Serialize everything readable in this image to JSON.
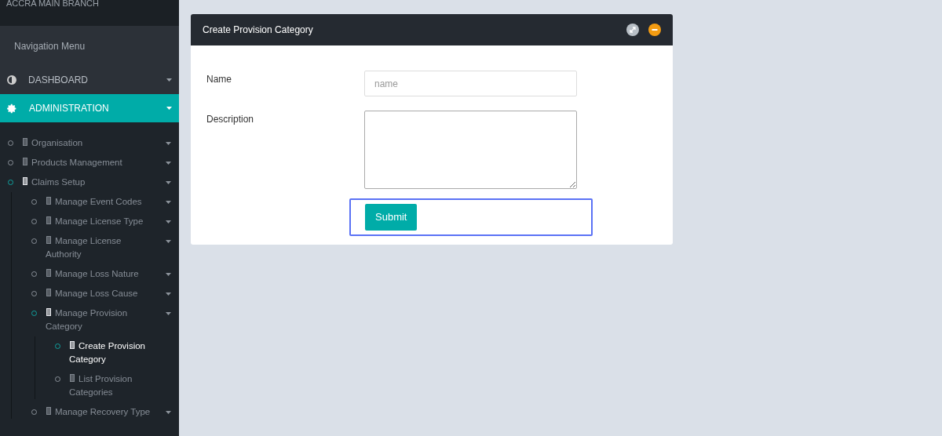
{
  "sidebar": {
    "branch": "ACCRA MAIN BRANCH",
    "nav_heading": "Navigation Menu",
    "sections": [
      {
        "label": "DASHBOARD",
        "kind": "dashboard",
        "selected": false
      },
      {
        "label": "ADMINISTRATION",
        "kind": "settings",
        "selected": true
      }
    ],
    "tree": [
      {
        "label": "Organisation",
        "active": false,
        "has_caret": true
      },
      {
        "label": "Products Management",
        "active": false,
        "has_caret": true
      },
      {
        "label": "Claims Setup",
        "active": true,
        "has_caret": true,
        "children": [
          {
            "label": "Manage Event Codes",
            "active": false,
            "has_caret": true
          },
          {
            "label": "Manage License Type",
            "active": false,
            "has_caret": true
          },
          {
            "label": "Manage License Authority",
            "active": false,
            "has_caret": true
          },
          {
            "label": "Manage Loss Nature",
            "active": false,
            "has_caret": true
          },
          {
            "label": "Manage Loss Cause",
            "active": false,
            "has_caret": true
          },
          {
            "label": "Manage Provision Category",
            "active": true,
            "has_caret": true,
            "children": [
              {
                "label": "Create Provision Category",
                "active": true,
                "has_caret": false
              },
              {
                "label": "List Provision Categories",
                "active": false,
                "has_caret": false
              }
            ]
          },
          {
            "label": "Manage Recovery Type",
            "active": false,
            "has_caret": true
          }
        ]
      }
    ]
  },
  "panel": {
    "title": "Create Provision Category",
    "fields": [
      {
        "label": "Name",
        "kind": "input",
        "placeholder": "name"
      },
      {
        "label": "Description",
        "kind": "textarea"
      }
    ],
    "submit": "Submit"
  }
}
